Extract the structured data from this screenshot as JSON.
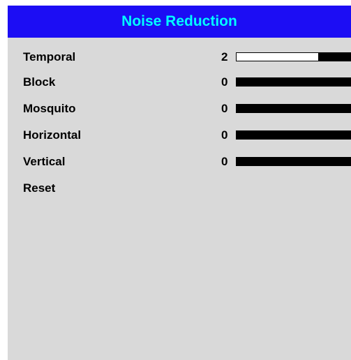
{
  "menu": {
    "title": "Noise Reduction",
    "items": [
      {
        "label": "Temporal",
        "value": "2",
        "level": 0.72
      },
      {
        "label": "Block",
        "value": "0",
        "level": 0
      },
      {
        "label": "Mosquito",
        "value": "0",
        "level": 0
      },
      {
        "label": "Horizontal",
        "value": "0",
        "level": 0
      },
      {
        "label": "Vertical",
        "value": "0",
        "level": 0
      },
      {
        "label": "Reset"
      }
    ]
  },
  "colors": {
    "title_bar": "#1c0df4",
    "title_text": "#00ffff",
    "panel_bg": "#d9d9d9",
    "slider_fill": "#000000",
    "slider_track": "#ffffff"
  }
}
